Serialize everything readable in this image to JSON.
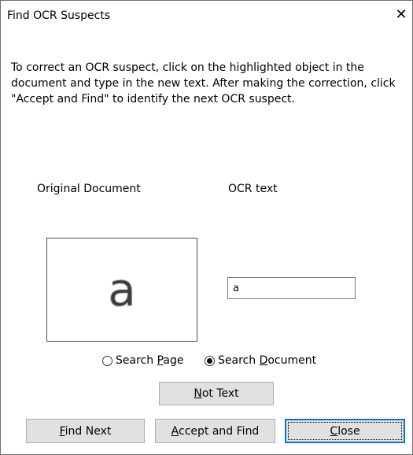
{
  "window": {
    "title": "Find OCR Suspects",
    "close_glyph": "✕"
  },
  "instructions": "To correct an OCR suspect, click on the highlighted object in the document and type in the new text. After making the correction, click \"Accept and Find\" to identify the next OCR suspect.",
  "labels": {
    "original_document": "Original Document",
    "ocr_text": "OCR text"
  },
  "preview": {
    "glyph": "a"
  },
  "ocr_input": {
    "value": "a"
  },
  "search_scope": {
    "options": [
      {
        "label_before": "Search ",
        "mnemonic": "P",
        "label_after": "age",
        "checked": false
      },
      {
        "label_before": "Search ",
        "mnemonic": "D",
        "label_after": "ocument",
        "checked": true
      }
    ]
  },
  "buttons": {
    "not_text": {
      "mnemonic": "N",
      "rest": "ot Text"
    },
    "find_next": {
      "mnemonic": "F",
      "rest": "ind Next"
    },
    "accept_and_find": {
      "mnemonic": "A",
      "rest": "ccept and Find"
    },
    "close": {
      "mnemonic": "C",
      "rest": "lose"
    }
  }
}
